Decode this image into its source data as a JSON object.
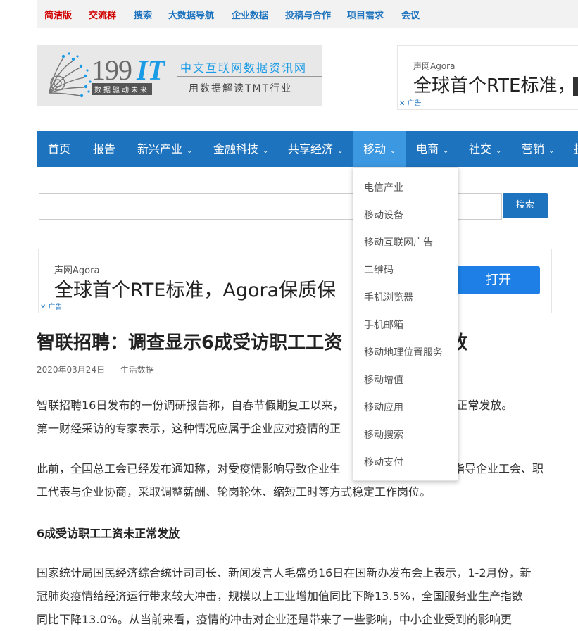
{
  "topbar": {
    "links": [
      "简洁版",
      "交流群",
      "搜索",
      "大数据导航",
      "企业数据",
      "投稿与合作",
      "项目需求",
      "会议"
    ]
  },
  "logo": {
    "number": "199",
    "it": "IT",
    "slogan": "数据驱动未来",
    "tagline": "中文互联网数据资讯网",
    "subtagline": "用数据解读TMT行业"
  },
  "ad_top": {
    "brand": "声网Agora",
    "headline": "全球首个RTE标准，",
    "label": "✕ 广告"
  },
  "nav": {
    "items": [
      "首页",
      "报告",
      "新兴产业",
      "金融科技",
      "共享经济",
      "移动",
      "电商",
      "社交",
      "营销",
      "技"
    ],
    "chevron": "⌄",
    "active_color": "#3c98e0",
    "bar_color": "#1e73be"
  },
  "search": {
    "placeholder": "",
    "button": "搜索"
  },
  "ad_mid": {
    "brand": "声网Agora",
    "headline": "全球首个RTE标准，Agora保质保",
    "button": "打开",
    "label": "✕ 广告"
  },
  "dropdown": {
    "items": [
      "电信产业",
      "移动设备",
      "移动互联网广告",
      "二维码",
      "手机浏览器",
      "手机邮箱",
      "移动地理位置服务",
      "移动增值",
      "移动应用",
      "移动搜索",
      "移动支付"
    ]
  },
  "article": {
    "title": "智联招聘：调查显示6成受访职工工资",
    "title_tail": "放",
    "date": "2020年03月24日",
    "category": "生活数据",
    "p1_a": "智联招聘16日发布的一份调研报告称，自春节假期复工以来，",
    "p1_b": "未能正常发放。",
    "p1_c": "第一财经采访的专家表示，这种情况应属于企业应对疫情的正",
    "p2_a": "此前，全国总工会已经发布通知称，对受疫情影响导致企业生",
    "p2_b": "指导企业工会、职",
    "p2_c": "工代表与企业协商，采取调整薪酬、轮岗轮休、缩短工时等方式稳定工作岗位。",
    "heading": "6成受访职工工资未正常发放",
    "p3_a": "国家统计局国民经济综合统计司司长、新闻发言人毛盛勇16日在国新办发布会上表示，1-2月份，新",
    "p3_b": "冠肺炎疫情给经济运行带来较大冲击，规模以上工业增加值同比下降13.5%，全国服务业生产指数",
    "p3_c": "同比下降13.0%。从当前来看，疫情的冲击对企业还是带来了一些影响，中小企业受到的影响更"
  }
}
